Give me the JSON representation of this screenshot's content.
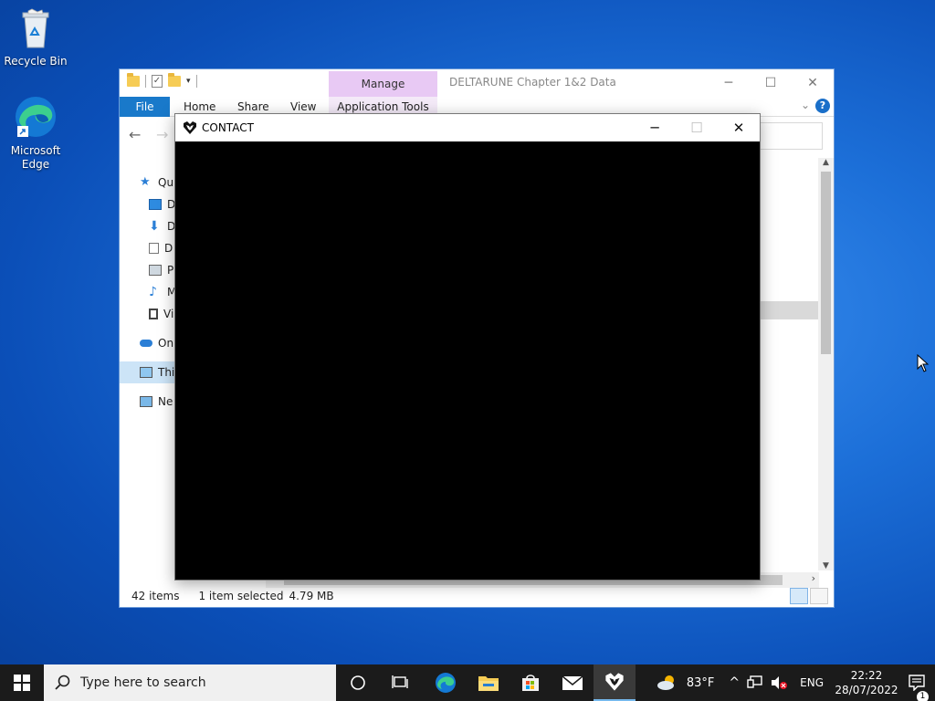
{
  "desktop": {
    "icons": [
      {
        "label": "Recycle Bin"
      },
      {
        "label": "Microsoft Edge"
      }
    ]
  },
  "explorer": {
    "title": "DELTARUNE Chapter 1&2 Data",
    "contextual_tab": "Manage",
    "ribbon_tabs": {
      "file": "File",
      "home": "Home",
      "share": "Share",
      "view": "View",
      "app_tools": "Application Tools"
    },
    "nav_items": [
      "Qu",
      "D",
      "D",
      "D",
      "Pi",
      "M",
      "Vi",
      "On",
      "Thi",
      "Ne"
    ],
    "status": {
      "count": "42 items",
      "selected": "1 item selected",
      "size": "4.79 MB"
    }
  },
  "contact_window": {
    "title": "CONTACT"
  },
  "taskbar": {
    "search_placeholder": "Type here to search",
    "weather_temp": "83°F",
    "language": "ENG",
    "time": "22:22",
    "date": "28/07/2022",
    "notification_count": "1"
  },
  "colors": {
    "accent": "#1979ca",
    "manage_tab": "#e8c9f4",
    "taskbar": "#1b1b1b"
  }
}
